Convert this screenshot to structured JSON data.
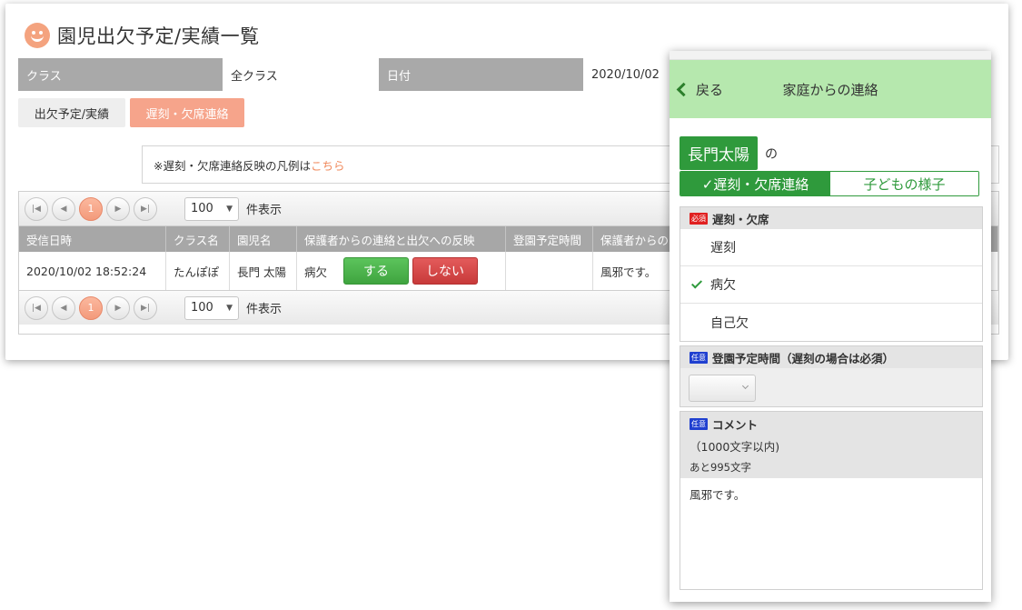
{
  "desktop": {
    "title": "園児出欠予定/実績一覧",
    "filters": {
      "class_label": "クラス",
      "class_value": "全クラス",
      "date_label": "日付",
      "date_value": "2020/10/02"
    },
    "tabs": {
      "attendance": "出欠予定/実績",
      "late_absence": "遅刻・欠席連絡"
    },
    "legend": {
      "text": "※遅刻・欠席連絡反映の凡例は",
      "link": "こちら"
    },
    "pager": {
      "current_page": "1",
      "page_size": "100",
      "page_size_label": "件表示"
    },
    "table": {
      "headers": [
        "受信日時",
        "クラス名",
        "園児名",
        "保護者からの連絡と出欠への反映",
        "登園予定時間",
        "保護者からの"
      ],
      "rows": [
        {
          "received": "2020/10/02 18:52:24",
          "class": "たんぽぽ",
          "child": "長門 太陽",
          "contact_type": "病欠",
          "yes_label": "する",
          "no_label": "しない",
          "arrival_time": "",
          "comment": "風邪です。"
        }
      ]
    }
  },
  "mobile": {
    "back_label": "戻る",
    "title": "家庭からの連絡",
    "child_name": "長門太陽",
    "particle": "の",
    "tab_active": "✓遅刻・欠席連絡",
    "tab_inactive": "子どもの様子",
    "section_type": {
      "badge": "必須",
      "title": "遅刻・欠席",
      "options": [
        "遅刻",
        "病欠",
        "自己欠"
      ],
      "selected": "病欠"
    },
    "section_time": {
      "badge": "任意",
      "title": "登園予定時間（遅刻の場合は必須）"
    },
    "section_comment": {
      "badge": "任意",
      "title": "コメント",
      "limit": "（1000文字以内)",
      "remaining": "あと995文字",
      "value": "風邪です。"
    }
  }
}
